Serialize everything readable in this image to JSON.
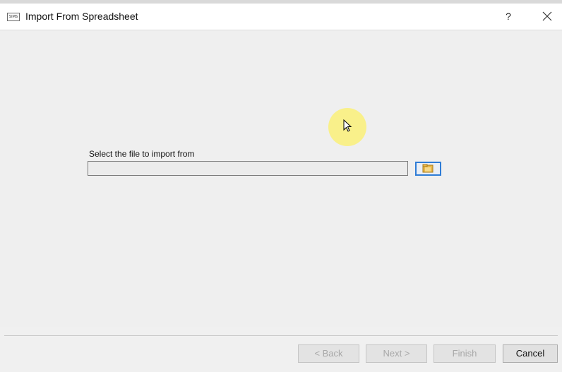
{
  "window": {
    "title": "Import From Spreadsheet",
    "app_icon_text": "SIMS",
    "help_label": "?",
    "close_label": "close"
  },
  "form": {
    "file_label": "Select the file to import from",
    "file_value": "",
    "browse_icon": "folder-browse-icon"
  },
  "footer": {
    "back_label": "< Back",
    "next_label": "Next >",
    "finish_label": "Finish",
    "cancel_label": "Cancel",
    "back_enabled": false,
    "next_enabled": false,
    "finish_enabled": false,
    "cancel_enabled": true
  },
  "colors": {
    "accent": "#2e7cd6",
    "cursor_highlight": "#faf078",
    "disabled_text": "#a8a8a8"
  }
}
